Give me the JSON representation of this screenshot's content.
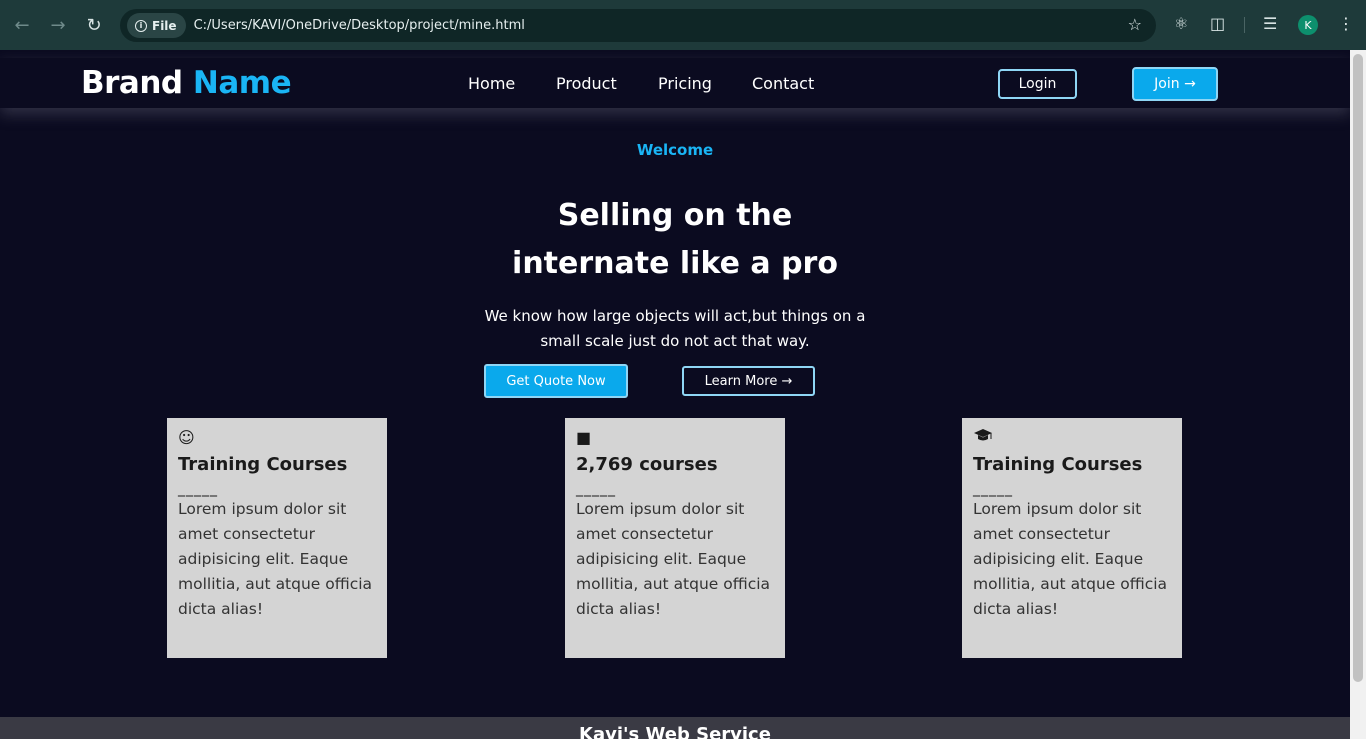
{
  "browser": {
    "chip_label": "File",
    "url": "C:/Users/KAVI/OneDrive/Desktop/project/mine.html",
    "profile_initial": "K"
  },
  "nav": {
    "brand_primary": "Brand",
    "brand_accent": "Name",
    "links": [
      "Home",
      "Product",
      "Pricing",
      "Contact"
    ],
    "login_label": "Login",
    "join_label": "Join →"
  },
  "hero": {
    "eyebrow": "Welcome",
    "headline_line1": "Selling on the",
    "headline_line2": "internate like a pro",
    "description": "We know how large objects will act,but things on a small scale just do not act that way.",
    "primary_cta": "Get Quote Now",
    "secondary_cta": "Learn More →"
  },
  "cards": [
    {
      "icon": "smile-icon",
      "title": "Training Courses",
      "dash": "_____",
      "body": "Lorem ipsum dolor sit amet consectetur adipisicing elit. Eaque mollitia, aut atque officia dicta alias!"
    },
    {
      "icon": "book-reader-icon",
      "title": "2,769 courses",
      "dash": "_____",
      "body": "Lorem ipsum dolor sit amet consectetur adipisicing elit. Eaque mollitia, aut atque officia dicta alias!"
    },
    {
      "icon": "graduation-cap-icon",
      "title": "Training Courses",
      "dash": "_____",
      "body": "Lorem ipsum dolor sit amet consectetur adipisicing elit. Eaque mollitia, aut atque officia dicta alias!"
    }
  ],
  "footer": {
    "title": "Kavi's Web Service"
  },
  "colors": {
    "accent": "#1ab5f5",
    "background": "#0b0b20",
    "card": "#d4d4d4"
  }
}
